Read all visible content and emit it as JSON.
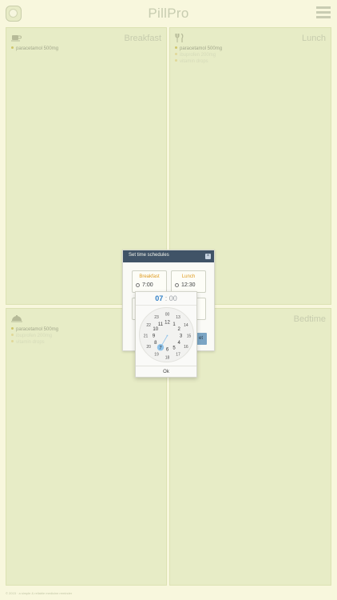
{
  "app": {
    "title": "PillPro"
  },
  "panels": {
    "breakfast": {
      "title": "Breakfast",
      "icon": "coffee-cup-icon",
      "meds": [
        "paracetamol 500mg"
      ]
    },
    "lunch": {
      "title": "Lunch",
      "icon": "fork-knife-icon",
      "meds": [
        "paracetamol 500mg",
        "ibuprofen 200mg",
        "vitamin drops"
      ]
    },
    "bedtime": {
      "title": "Bedtime",
      "icon": "bed-icon",
      "meds": [
        "paracetamol 500mg",
        "ibuprofen 200mg",
        "vitamin drops"
      ]
    }
  },
  "dialog": {
    "title": "Set time schedules",
    "close_icon": "close-icon",
    "slots": [
      {
        "label": "Breakfast",
        "time": "7:00"
      },
      {
        "label": "Lunch",
        "time": "12:30"
      }
    ],
    "button_fragment": "et"
  },
  "picker": {
    "hour": "07",
    "separator": ":",
    "minute": "00",
    "ok": "Ok",
    "selected_hour": "7",
    "outer_hours": [
      "00",
      "13",
      "14",
      "15",
      "16",
      "17",
      "18",
      "19",
      "20",
      "21",
      "22",
      "23"
    ],
    "inner_hours": [
      "12",
      "1",
      "2",
      "3",
      "4",
      "5",
      "6",
      "7",
      "8",
      "9",
      "10",
      "11"
    ]
  },
  "footer": {
    "text": "© 2015 · a simple & reliable medicine reminder"
  },
  "colors": {
    "panel": "#e7ecc6",
    "dialog_header": "#405367",
    "accent_orange": "#de9a1e",
    "accent_blue": "#2f7fc6",
    "button": "#7ba5c4"
  }
}
